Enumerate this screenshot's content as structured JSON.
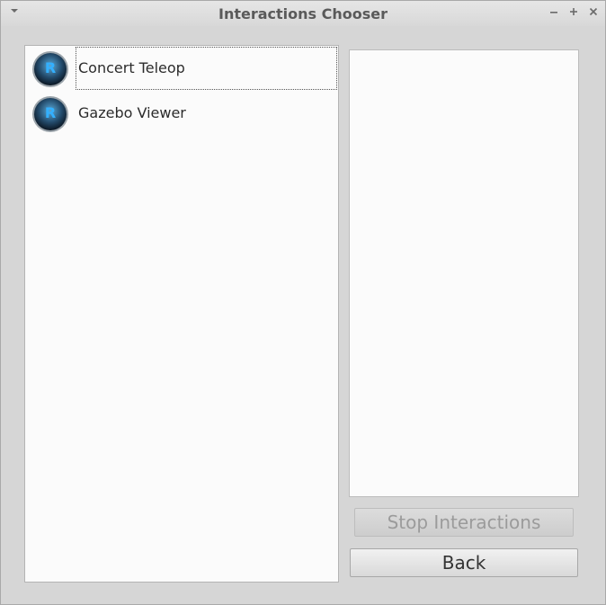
{
  "window": {
    "title": "Interactions Chooser"
  },
  "interactions": [
    {
      "label": "Concert Teleop",
      "icon": "ros-logo-icon",
      "selected": true
    },
    {
      "label": "Gazebo Viewer",
      "icon": "ros-logo-icon",
      "selected": false
    }
  ],
  "buttons": {
    "stop_label": "Stop Interactions",
    "back_label": "Back"
  },
  "colors": {
    "accent_blue": "#1e8fe6",
    "window_bg": "#d6d6d6",
    "panel_bg": "#fbfbfb"
  }
}
